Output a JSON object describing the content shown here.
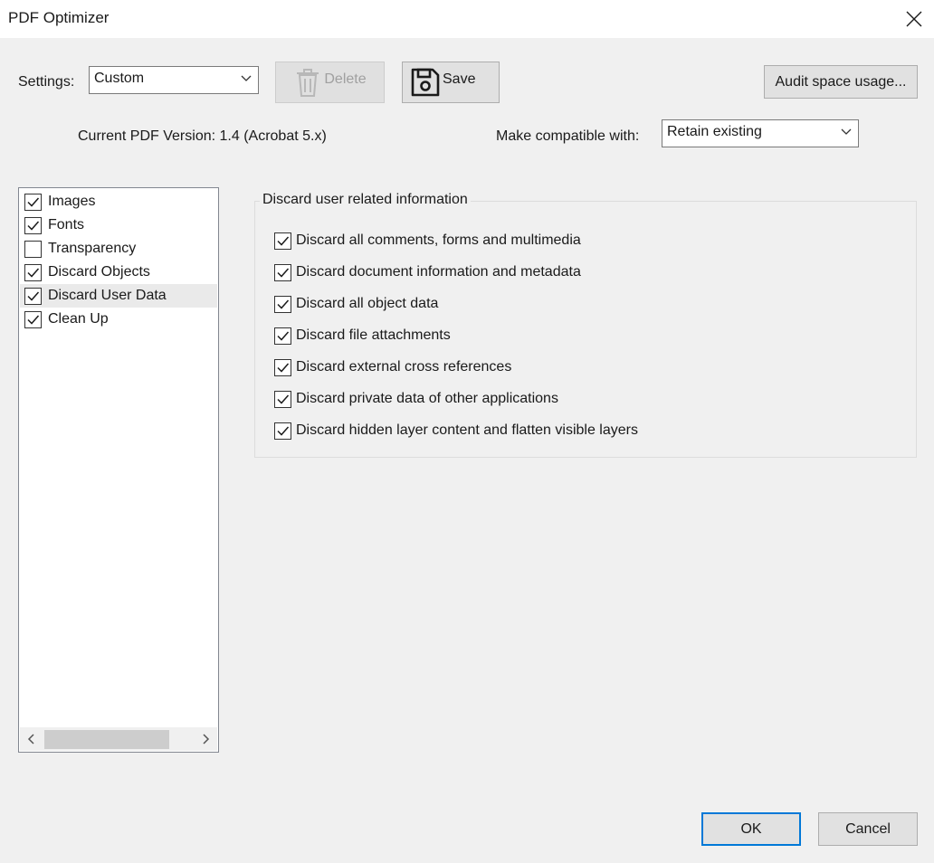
{
  "window": {
    "title": "PDF Optimizer"
  },
  "toolbar": {
    "settings_label": "Settings:",
    "settings_value": "Custom",
    "delete_label": "Delete",
    "save_label": "Save",
    "audit_label": "Audit space usage..."
  },
  "version": {
    "current_label": "Current PDF Version: 1.4 (Acrobat 5.x)",
    "compat_label": "Make compatible with:",
    "compat_value": "Retain existing"
  },
  "panels": [
    {
      "label": "Images",
      "checked": true,
      "selected": false
    },
    {
      "label": "Fonts",
      "checked": true,
      "selected": false
    },
    {
      "label": "Transparency",
      "checked": false,
      "selected": false
    },
    {
      "label": "Discard Objects",
      "checked": true,
      "selected": false
    },
    {
      "label": "Discard User Data",
      "checked": true,
      "selected": true
    },
    {
      "label": "Clean Up",
      "checked": true,
      "selected": false
    }
  ],
  "group": {
    "title": "Discard user related information",
    "options": [
      {
        "label": "Discard all comments, forms and multimedia",
        "checked": true
      },
      {
        "label": "Discard document information and metadata",
        "checked": true
      },
      {
        "label": "Discard all object data",
        "checked": true
      },
      {
        "label": "Discard file attachments",
        "checked": true
      },
      {
        "label": "Discard external cross references",
        "checked": true
      },
      {
        "label": "Discard private data of other applications",
        "checked": true
      },
      {
        "label": "Discard hidden layer content and flatten visible layers",
        "checked": true
      }
    ]
  },
  "footer": {
    "ok_label": "OK",
    "cancel_label": "Cancel"
  },
  "icons": {
    "close": "close-icon",
    "dropdown": "chevron-down-icon",
    "trash": "trash-icon",
    "save": "floppy-disk-icon",
    "check": "checkmark-icon"
  },
  "colors": {
    "accent": "#0078d7",
    "window_bg": "#f0f0f0",
    "titlebar_bg": "#ffffff"
  }
}
